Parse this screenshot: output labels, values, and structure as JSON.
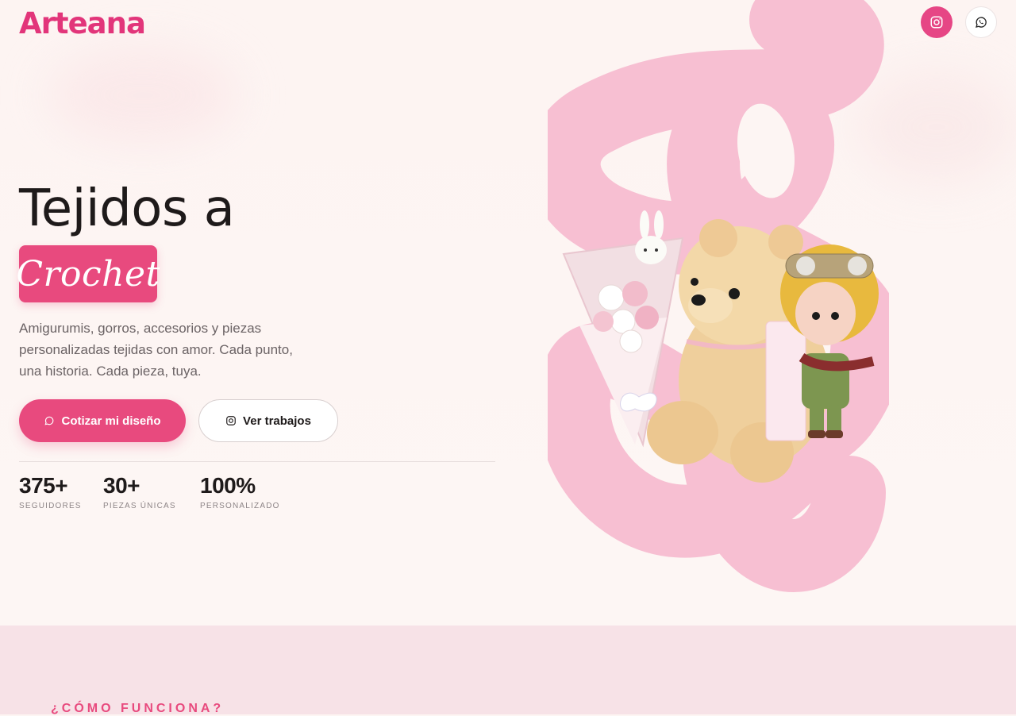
{
  "header": {
    "logo": "Arteana",
    "social": [
      {
        "name": "instagram-icon"
      },
      {
        "name": "whatsapp-icon"
      }
    ]
  },
  "hero": {
    "title_line1": "Tejidos a",
    "title_highlight": "Crochet",
    "description": "Amigurumis, gorros, accesorios y piezas personalizadas tejidas con amor. Cada punto, una historia. Cada pieza, tuya.",
    "cta_primary": "Cotizar mi diseño",
    "cta_secondary": "Ver trabajos",
    "stats": [
      {
        "value": "375+",
        "label": "SEGUIDORES"
      },
      {
        "value": "30+",
        "label": "PIEZAS ÚNICAS"
      },
      {
        "value": "100%",
        "label": "PERSONALIZADO"
      }
    ]
  },
  "how_it_works": {
    "eyebrow": "¿CÓMO FUNCIONA?"
  },
  "colors": {
    "brand": "#e84a7e",
    "logo": "#e2357a",
    "background": "#fdf5f3",
    "section_bg": "#f7e2e7",
    "art_pink": "#f7bfd2"
  }
}
